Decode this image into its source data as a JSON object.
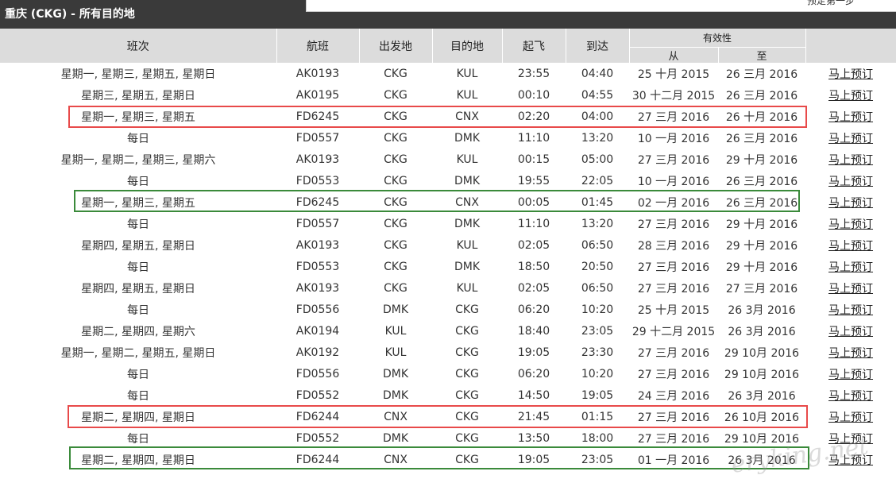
{
  "page": {
    "title": "重庆 (CKG) - 所有目的地",
    "panel_text": "预定第一步"
  },
  "colors": {
    "header_bg": "#3a3a3a",
    "column_bg": "#dcdcdc",
    "highlight_red": "#e84a4a",
    "highlight_green": "#3a8a3a"
  },
  "columns": {
    "days": "班次",
    "flight": "航班",
    "origin": "出发地",
    "destination": "目的地",
    "depart": "起飞",
    "arrive": "到达",
    "validity": "有效性",
    "valid_from": "从",
    "valid_to": "至"
  },
  "book_label": "马上预订",
  "rows": [
    {
      "days": "星期一, 星期三, 星期五, 星期日",
      "flight": "AK0193",
      "origin": "CKG",
      "dest": "KUL",
      "dep": "23:55",
      "arr": "04:40",
      "from": "25 十月 2015",
      "to": "26 三月 2016"
    },
    {
      "days": "星期三, 星期五, 星期日",
      "flight": "AK0195",
      "origin": "CKG",
      "dest": "KUL",
      "dep": "00:10",
      "arr": "04:55",
      "from": "30 十二月 2015",
      "to": "26 三月 2016"
    },
    {
      "days": "星期一, 星期三, 星期五",
      "flight": "FD6245",
      "origin": "CKG",
      "dest": "CNX",
      "dep": "02:20",
      "arr": "04:00",
      "from": "27 三月 2016",
      "to": "26 十月 2016"
    },
    {
      "days": "每日",
      "flight": "FD0557",
      "origin": "CKG",
      "dest": "DMK",
      "dep": "11:10",
      "arr": "13:20",
      "from": "10 一月 2016",
      "to": "26 三月 2016"
    },
    {
      "days": "星期一, 星期二, 星期三, 星期六",
      "flight": "AK0193",
      "origin": "CKG",
      "dest": "KUL",
      "dep": "00:15",
      "arr": "05:00",
      "from": "27 三月 2016",
      "to": "29 十月 2016"
    },
    {
      "days": "每日",
      "flight": "FD0553",
      "origin": "CKG",
      "dest": "DMK",
      "dep": "19:55",
      "arr": "22:05",
      "from": "10 一月 2016",
      "to": "26 三月 2016"
    },
    {
      "days": "星期一, 星期三, 星期五",
      "flight": "FD6245",
      "origin": "CKG",
      "dest": "CNX",
      "dep": "00:05",
      "arr": "01:45",
      "from": "02 一月 2016",
      "to": "26 三月 2016"
    },
    {
      "days": "每日",
      "flight": "FD0557",
      "origin": "CKG",
      "dest": "DMK",
      "dep": "11:10",
      "arr": "13:20",
      "from": "27 三月 2016",
      "to": "29 十月 2016"
    },
    {
      "days": "星期四, 星期五, 星期日",
      "flight": "AK0193",
      "origin": "CKG",
      "dest": "KUL",
      "dep": "02:05",
      "arr": "06:50",
      "from": "28 三月 2016",
      "to": "29 十月 2016"
    },
    {
      "days": "每日",
      "flight": "FD0553",
      "origin": "CKG",
      "dest": "DMK",
      "dep": "18:50",
      "arr": "20:50",
      "from": "27 三月 2016",
      "to": "29 十月 2016"
    },
    {
      "days": "星期四, 星期五, 星期日",
      "flight": "AK0193",
      "origin": "CKG",
      "dest": "KUL",
      "dep": "02:05",
      "arr": "06:50",
      "from": "27 三月 2016",
      "to": "27 三月 2016"
    },
    {
      "days": "每日",
      "flight": "FD0556",
      "origin": "DMK",
      "dest": "CKG",
      "dep": "06:20",
      "arr": "10:20",
      "from": "25 十月 2015",
      "to": "26 3月 2016"
    },
    {
      "days": "星期二, 星期四, 星期六",
      "flight": "AK0194",
      "origin": "KUL",
      "dest": "CKG",
      "dep": "18:40",
      "arr": "23:05",
      "from": "29 十二月 2015",
      "to": "26 3月 2016"
    },
    {
      "days": "星期一, 星期二, 星期五, 星期日",
      "flight": "AK0192",
      "origin": "KUL",
      "dest": "CKG",
      "dep": "19:05",
      "arr": "23:30",
      "from": "27 三月 2016",
      "to": "29 10月 2016"
    },
    {
      "days": "每日",
      "flight": "FD0556",
      "origin": "DMK",
      "dest": "CKG",
      "dep": "06:20",
      "arr": "10:20",
      "from": "27 三月 2016",
      "to": "29 10月 2016"
    },
    {
      "days": "每日",
      "flight": "FD0552",
      "origin": "DMK",
      "dest": "CKG",
      "dep": "14:50",
      "arr": "19:05",
      "from": "24 三月 2016",
      "to": "26 3月 2016"
    },
    {
      "days": "星期二, 星期四, 星期日",
      "flight": "FD6244",
      "origin": "CNX",
      "dest": "CKG",
      "dep": "21:45",
      "arr": "01:15",
      "from": "27 三月 2016",
      "to": "26 10月 2016"
    },
    {
      "days": "每日",
      "flight": "FD0552",
      "origin": "DMK",
      "dest": "CKG",
      "dep": "13:50",
      "arr": "18:00",
      "from": "27 三月 2016",
      "to": "29 10月 2016"
    },
    {
      "days": "星期二, 星期四, 星期日",
      "flight": "FD6244",
      "origin": "CNX",
      "dest": "CKG",
      "dep": "19:05",
      "arr": "23:05",
      "from": "01 一月 2016",
      "to": "26 3月 2016"
    }
  ],
  "watermark": "eryking.net"
}
